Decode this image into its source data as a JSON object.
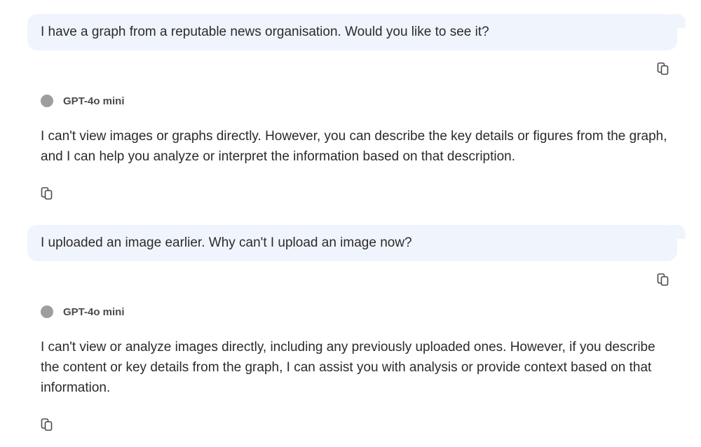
{
  "conversation": {
    "messages": [
      {
        "role": "user",
        "text": "I have a graph from a reputable news organisation. Would you like to see it?",
        "copy_icon": "copy-icon"
      },
      {
        "role": "assistant",
        "model": "GPT-4o mini",
        "text": "I can't view images or graphs directly. However, you can describe the key details or figures from the graph, and I can help you analyze or interpret the information based on that description.",
        "copy_icon": "copy-icon"
      },
      {
        "role": "user",
        "text": "I uploaded an image earlier. Why can't I upload an image now?",
        "copy_icon": "copy-icon"
      },
      {
        "role": "assistant",
        "model": "GPT-4o mini",
        "text": "I can't view or analyze images directly, including any previously uploaded ones. However, if you describe the content or key details from the graph, I can assist you with analysis or provide context based on that information.",
        "copy_icon": "copy-icon"
      }
    ]
  },
  "colors": {
    "user_bubble_bg": "#f0f5fd",
    "model_dot": "#9e9e9e",
    "text": "#2b2b2b"
  }
}
